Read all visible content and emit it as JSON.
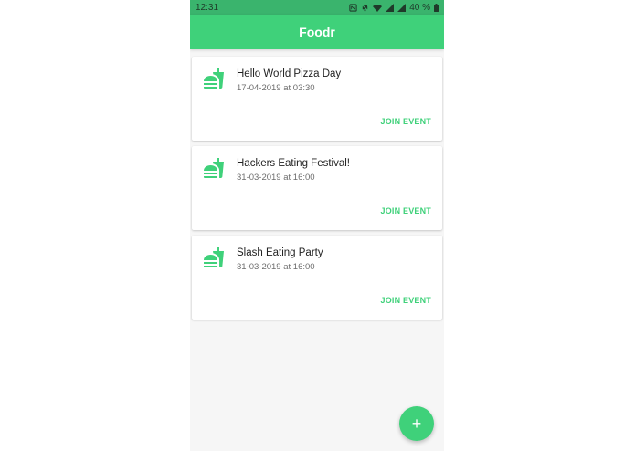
{
  "status_bar": {
    "time": "12:31",
    "battery": "40 %"
  },
  "app_bar": {
    "title": "Foodr"
  },
  "events": [
    {
      "title": "Hello World Pizza Day",
      "date": "17-04-2019 at 03:30",
      "action": "JOIN EVENT",
      "icon": "fastfood-icon"
    },
    {
      "title": "Hackers Eating Festival!",
      "date": "31-03-2019 at 16:00",
      "action": "JOIN EVENT",
      "icon": "fastfood-icon"
    },
    {
      "title": "Slash Eating Party",
      "date": "31-03-2019 at 16:00",
      "action": "JOIN EVENT",
      "icon": "fastfood-icon"
    }
  ],
  "fab": {
    "label": "+",
    "icon": "add-icon"
  },
  "colors": {
    "accent": "#3fd17a",
    "status_bar": "#3ab46d",
    "background": "#f6f6f6"
  }
}
